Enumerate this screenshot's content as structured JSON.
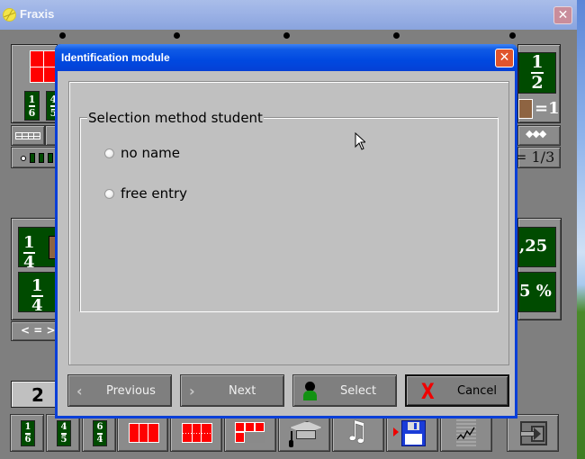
{
  "app": {
    "title": "Fraxis",
    "close_label": "✕"
  },
  "left_top_panel": {
    "fractions": [
      {
        "num": "1",
        "den": "6"
      },
      {
        "num": "4",
        "den": "5"
      }
    ]
  },
  "right_top_panel": {
    "fraction": {
      "num": "1",
      "den": "2"
    },
    "unit_label": "=1",
    "ratio_label": "= 1/3"
  },
  "left_mid_panel": {
    "fractions": [
      {
        "num": "1",
        "den": "4"
      },
      {
        "num": "1",
        "den": "4"
      }
    ],
    "compare_label": "< = >"
  },
  "right_mid_panel": {
    "decimal": ",25",
    "percent": "5 %"
  },
  "counter": {
    "value": "2"
  },
  "bottom_toolbar": {
    "fraction_buttons": [
      {
        "num": "1",
        "den": "6"
      },
      {
        "num": "4",
        "den": "5"
      },
      {
        "num": "6",
        "den": "4"
      }
    ],
    "icons": [
      "bar-three-parts-icon",
      "bar-divided-icon",
      "partial-bar-icon",
      "graduation-cap-icon",
      "music-notes-icon",
      "save-disk-icon",
      "chart-report-icon",
      "exit-icon"
    ]
  },
  "dialog": {
    "title": "Identification module",
    "close_label": "✕",
    "group_title": "Selection method student",
    "options": [
      {
        "label": "no name",
        "selected": false
      },
      {
        "label": "free entry",
        "selected": false
      }
    ],
    "buttons": {
      "previous": "Previous",
      "next": "Next",
      "select": "Select",
      "cancel": "Cancel"
    }
  }
}
